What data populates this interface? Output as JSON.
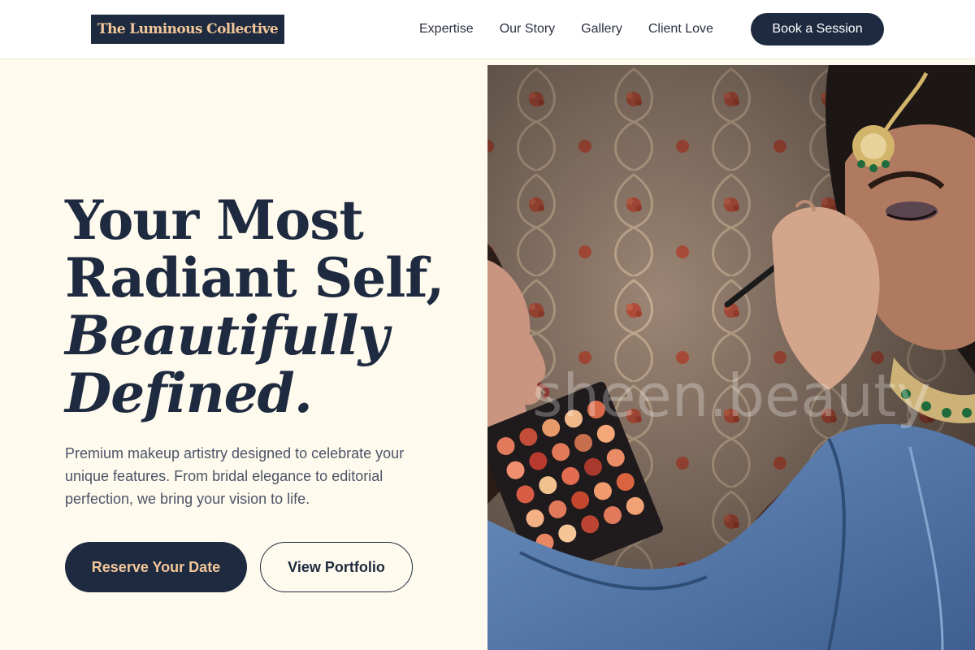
{
  "brand": {
    "name": "The Luminous Collective"
  },
  "nav": {
    "links": [
      "Expertise",
      "Our Story",
      "Gallery",
      "Client Love"
    ],
    "cta_label": "Book a Session"
  },
  "hero": {
    "headline": {
      "line1": "Your Most",
      "line2": "Radiant Self,",
      "line3": "Beautifully",
      "line4": "Defined."
    },
    "description": "Premium makeup artistry designed to celebrate your unique features. From bridal elegance to editorial perfection, we bring your vision to life.",
    "primary_button": "Reserve Your Date",
    "secondary_button": "View Portfolio",
    "image_watermark": "sheen.beauty"
  },
  "colors": {
    "navy": "#1e2a3f",
    "gold": "#f3c79a",
    "cream": "#fffaee",
    "body_text": "#4c5467"
  }
}
